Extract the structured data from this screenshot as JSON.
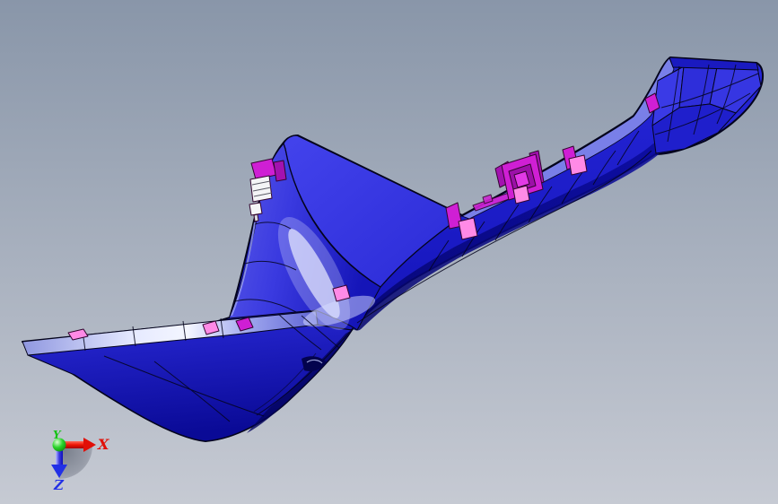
{
  "viewport": {
    "kind": "cad-3d-model-view",
    "triad": {
      "x": {
        "label": "X"
      },
      "y": {
        "label": "Y"
      },
      "z": {
        "label": "Z"
      }
    }
  },
  "colors": {
    "bg-top": "#8996a9",
    "bg-bottom": "#c6cad3",
    "part-blue": "#2b2bdf",
    "part-blue-bright": "#3d3dea",
    "part-blue-dark": "#0b0ba8",
    "part-blue-deepest": "#04045e",
    "part-edge": "#04041c",
    "part-lavender": "#7e85ea",
    "part-highlight": "#eef0ff",
    "clip-magenta": "#cf1fd4",
    "clip-magenta-dark": "#a312b0",
    "clip-pink": "#ff8ae6",
    "clip-white": "#f4f4f6",
    "axis-x": "#e11008",
    "axis-y": "#17c217",
    "axis-z": "#2230e6",
    "triad-disc": "#8e939f"
  }
}
